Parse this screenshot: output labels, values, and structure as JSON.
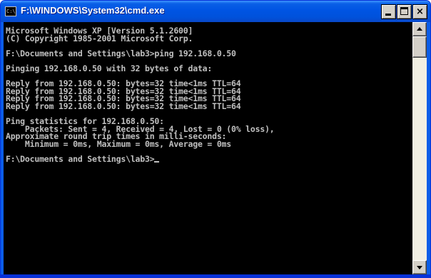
{
  "window": {
    "title": "F:\\WINDOWS\\System32\\cmd.exe",
    "icon_text": "C:\\",
    "buttons": {
      "minimize": "minimize",
      "maximize": "maximize",
      "close": "×"
    }
  },
  "console": {
    "lines": [
      "Microsoft Windows XP [Version 5.1.2600]",
      "(C) Copyright 1985-2001 Microsoft Corp.",
      "",
      "F:\\Documents and Settings\\lab3>ping 192.168.0.50",
      "",
      "Pinging 192.168.0.50 with 32 bytes of data:",
      "",
      "Reply from 192.168.0.50: bytes=32 time<1ms TTL=64",
      "Reply from 192.168.0.50: bytes=32 time<1ms TTL=64",
      "Reply from 192.168.0.50: bytes=32 time<1ms TTL=64",
      "Reply from 192.168.0.50: bytes=32 time<1ms TTL=64",
      "",
      "Ping statistics for 192.168.0.50:",
      "    Packets: Sent = 4, Received = 4, Lost = 0 (0% loss),",
      "Approximate round trip times in milli-seconds:",
      "    Minimum = 0ms, Maximum = 0ms, Average = 0ms",
      "",
      "F:\\Documents and Settings\\lab3>"
    ]
  },
  "colors": {
    "titlebar": "#0054e3",
    "console_bg": "#000000",
    "console_text": "#c0c0c0"
  },
  "icons": {
    "app": "cmd-icon",
    "scroll_up": "arrow-up-icon",
    "scroll_down": "arrow-down-icon"
  }
}
